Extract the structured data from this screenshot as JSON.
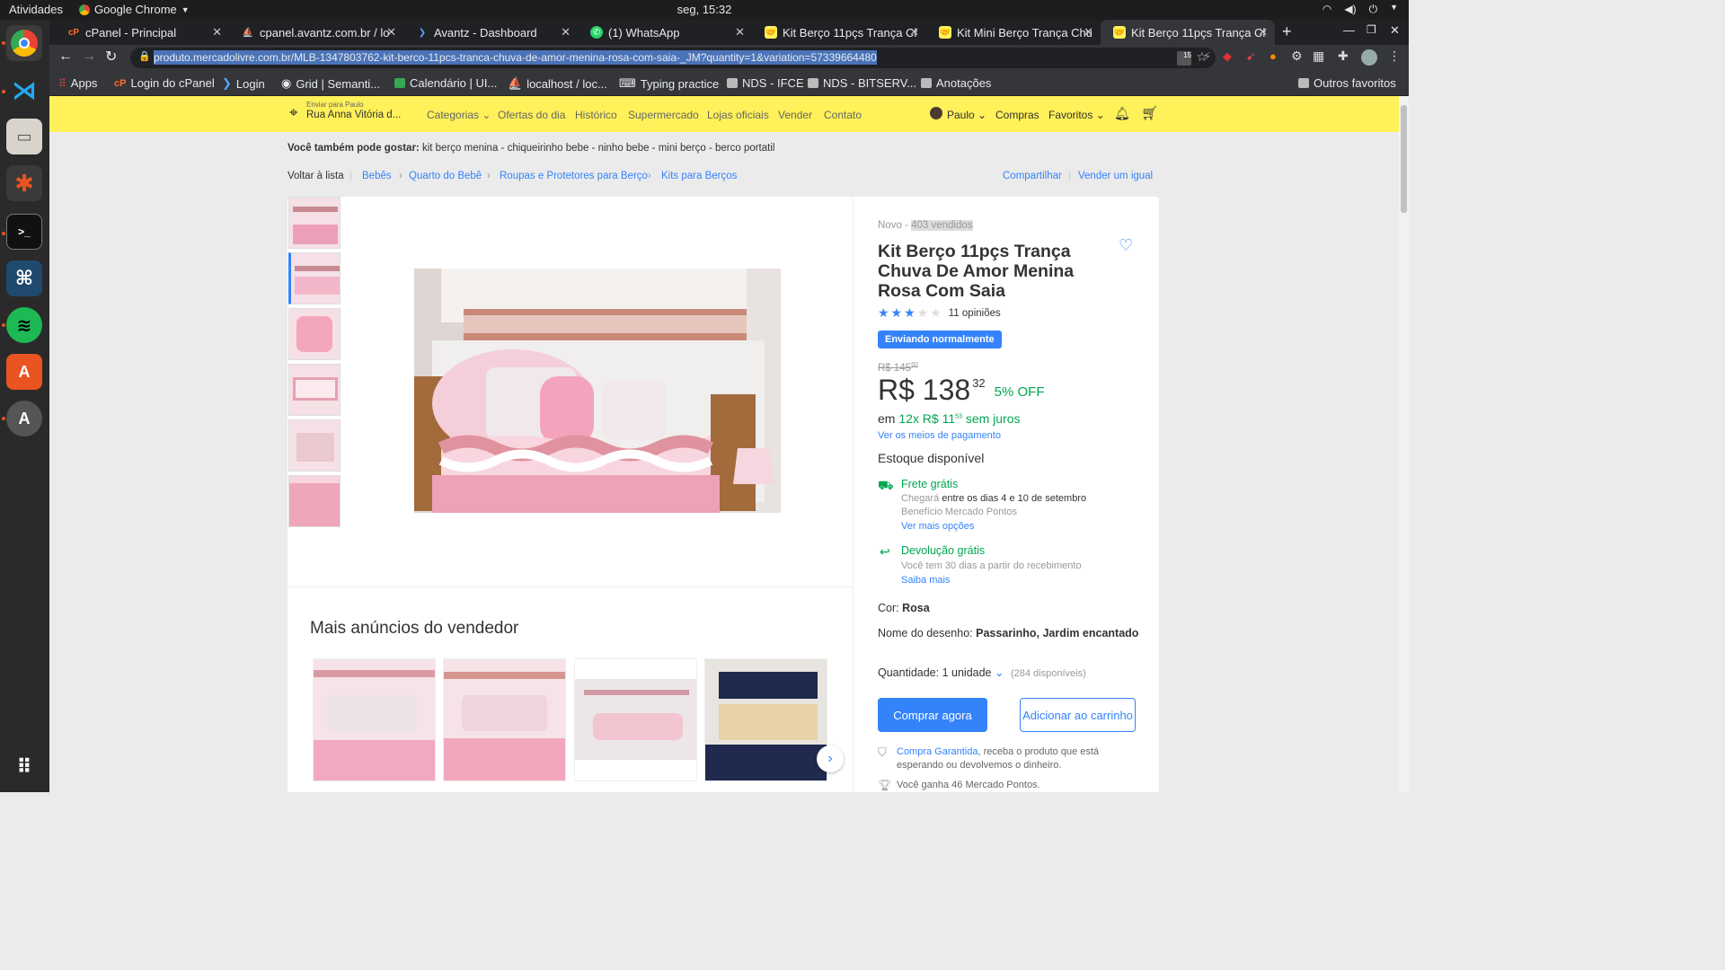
{
  "os": {
    "activities": "Atividades",
    "app_name": "Google Chrome",
    "clock": "seg, 15:32"
  },
  "tabs": [
    {
      "title": "cPanel - Principal"
    },
    {
      "title": "cpanel.avantz.com.br / lo"
    },
    {
      "title": "Avantz - Dashboard"
    },
    {
      "title": "(1) WhatsApp"
    },
    {
      "title": "Kit Berço 11pçs Trança Ch"
    },
    {
      "title": "Kit Mini Berço Trança Chu"
    },
    {
      "title": "Kit Berço 11pçs Trança Ch"
    }
  ],
  "url": "produto.mercadolivre.com.br/MLB-1347803762-kit-berco-11pcs-tranca-chuva-de-amor-menina-rosa-com-saia-_JM?quantity=1&variation=57339664480",
  "extension_badge": "15",
  "bookmarks": {
    "apps": "Apps",
    "items": [
      "Login do cPanel",
      "Login",
      "Grid | Semanti...",
      "Calendário | UI...",
      "localhost / loc...",
      "Typing practice",
      "NDS - IFCE",
      "NDS - BITSERV...",
      "Anotações"
    ],
    "other": "Outros favoritos"
  },
  "header": {
    "ship_to_label": "Enviar para Paulo",
    "ship_to_address": "Rua Anna Vitória d...",
    "nav": [
      "Categorias",
      "Ofertas do dia",
      "Histórico",
      "Supermercado",
      "Lojas oficiais",
      "Vender",
      "Contato"
    ],
    "user": "Paulo",
    "compras": "Compras",
    "favoritos": "Favoritos"
  },
  "recommend": {
    "label": "Você também pode gostar:",
    "items": "kit berço menina - chiqueirinho bebe - ninho bebe - mini berço - berco portatil"
  },
  "breadcrumb": {
    "back": "Voltar à lista",
    "items": [
      "Bebês",
      "Quarto do Bebê",
      "Roupas e Protetores para Berço",
      "Kits para Berços"
    ],
    "share": "Compartilhar",
    "sell_same": "Vender um igual"
  },
  "product": {
    "condition": "Novo",
    "sold": "403 vendidos",
    "title": "Kit Berço 11pçs Trança Chuva De Amor Menina Rosa Com Saia",
    "rating": 3,
    "reviews": "11 opiniões",
    "status_badge": "Enviando normalmente",
    "old_price": "R$ 145",
    "old_cents": "60",
    "price": "R$ 138",
    "price_cents": "32",
    "discount": "5% OFF",
    "installments_pre": "em",
    "installments": "12x R$ 11",
    "installments_cents": "53",
    "installments_post": "sem juros",
    "payment_link": "Ver os meios de pagamento",
    "stock": "Estoque disponível",
    "shipping_title": "Frete grátis",
    "shipping_arrives": "Chegará",
    "shipping_dates": "entre os dias 4 e 10 de setembro",
    "shipping_benefit": "Benefício Mercado Pontos",
    "shipping_more": "Ver mais opções",
    "return_title": "Devolução grátis",
    "return_desc": "Você tem 30 dias a partir do recebimento",
    "return_more": "Saiba mais",
    "color_label": "Cor:",
    "color_value": "Rosa",
    "design_label": "Nome do desenho:",
    "design_value": "Passarinho, Jardim encantado",
    "qty_label": "Quantidade:",
    "qty_value": "1 unidade",
    "qty_available": "(284 disponíveis)",
    "buy_now": "Comprar agora",
    "add_cart": "Adicionar ao carrinho",
    "guarantee_link": "Compra Garantida",
    "guarantee_text": ", receba o produto que está esperando ou devolvemos o dinheiro.",
    "points": "Você ganha 46 Mercado Pontos."
  },
  "seller_more": {
    "title": "Mais anúncios do vendedor"
  },
  "colors": {
    "ml_yellow": "#fff159",
    "accent_blue": "#3483fa",
    "green": "#00a650"
  }
}
